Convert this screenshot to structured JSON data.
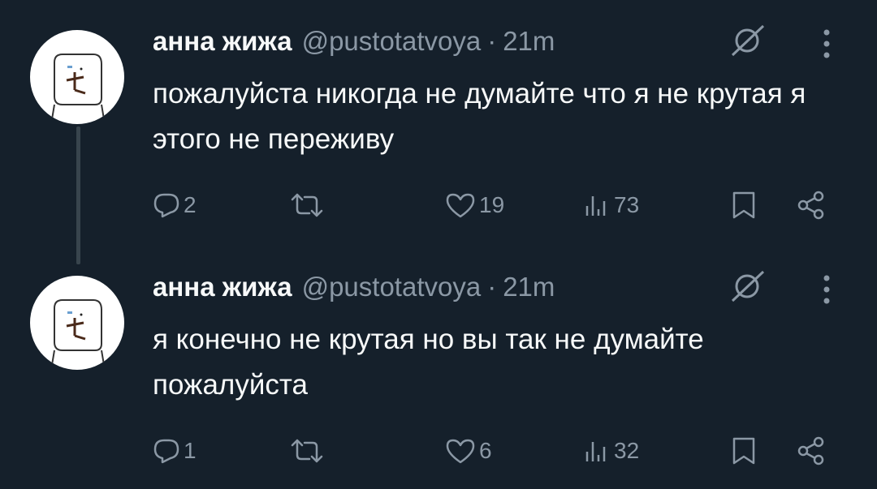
{
  "tweets": [
    {
      "author_name": "анна жижа",
      "handle": "@pustotatvoya",
      "separator": "·",
      "time": "21m",
      "text": "пожалуйста никогда не думайте что я не крутая я этого не переживу",
      "replies": "2",
      "likes": "19",
      "views": "73"
    },
    {
      "author_name": "анна жижа",
      "handle": "@pustotatvoya",
      "separator": "·",
      "time": "21m",
      "text": "я конечно не крутая но вы так не думайте пожалуйста",
      "replies": "1",
      "likes": "6",
      "views": "32"
    }
  ],
  "colors": {
    "background": "#15202b",
    "text": "#f7f9f9",
    "secondary": "#8b98a5",
    "thread_line": "#38444d"
  },
  "icons": [
    "avatar-drawing",
    "slashed-circle-icon",
    "more-icon",
    "reply-icon",
    "retweet-icon",
    "like-icon",
    "views-icon",
    "bookmark-icon",
    "share-icon"
  ]
}
